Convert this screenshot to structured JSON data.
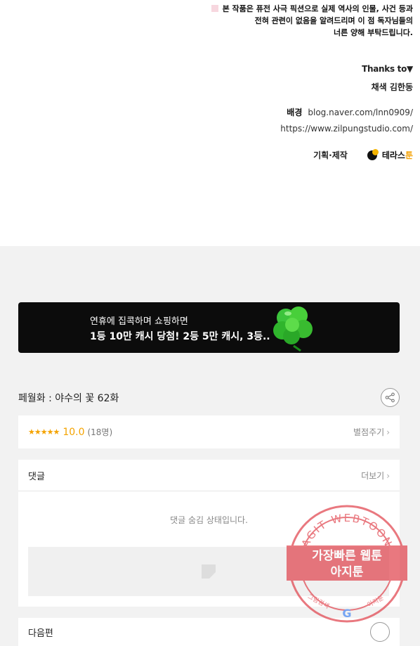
{
  "credits": {
    "notice_lines": [
      "본 작품은 퓨전 사극 픽션으로 실제 역사의 인물, 사건 등과",
      "전혀 관련이 없음을 알려드리며 이 점 독자님들의",
      "너른 양해 부탁드립니다."
    ],
    "thanks_label": "Thanks to▼",
    "thanks_name": "채색 김한동",
    "background_label": "배경",
    "background_url1": "blog.naver.com/lnn0909/",
    "background_url2": "https://www.zilpungstudio.com/",
    "planning_label": "기획·제작",
    "logo_text_1": "테라스",
    "logo_text_2": "툰"
  },
  "banner": {
    "line1": "연휴에 집콕하며 쇼핑하면",
    "line2": "1등 10만 캐시 당첨! 2등 5만 캐시, 3등.."
  },
  "episode": {
    "title": "페월화 : 야수의 꽃 62화"
  },
  "rating": {
    "stars": "★★★★★",
    "score": "10.0",
    "count": "(18명)",
    "rate_link": "별점주기",
    "chevron": "›"
  },
  "comments": {
    "title": "댓글",
    "more": "더보기",
    "chevron": "›",
    "hidden_message": "댓글 숨김 상태입니다."
  },
  "next": {
    "label": "다음편"
  },
  "watermark": {
    "top_text": "AGIT WEBTOON",
    "line1": "가장빠른 웹툰",
    "line2": "아지툰",
    "bottom_left": "그림검색",
    "bottom_right": "아지툰",
    "g_letter": "G"
  },
  "colors": {
    "star": "#f4a300",
    "banner_bg": "#0c0c0c",
    "page_bg": "#f2f2f2",
    "stamp": "#e0404a"
  }
}
